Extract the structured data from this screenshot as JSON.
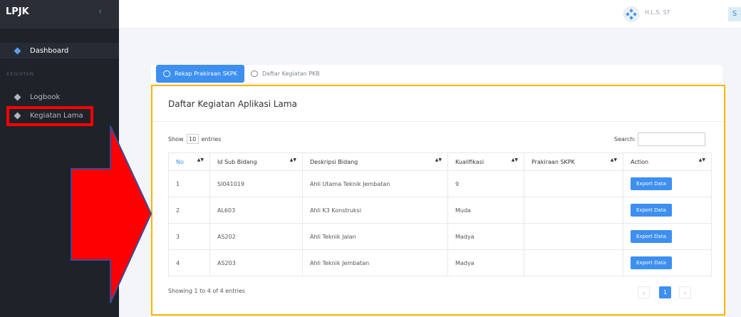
{
  "app": {
    "brand": "LPJK",
    "collapse_glyph": "‹"
  },
  "sidebar": {
    "dashboard_label": "Dashboard",
    "section_label": "KEGIATAN",
    "items": [
      {
        "label": "Logbook"
      },
      {
        "label": "Kegiatan Lama"
      }
    ]
  },
  "header": {
    "user_name": "H.L.S. ST",
    "avatar_letter": "S"
  },
  "tabs": [
    {
      "label": "Rekap Prakiraan SKPK",
      "active": true
    },
    {
      "label": "Daftar Kegiatan PKB",
      "active": false
    }
  ],
  "card": {
    "title": "Daftar Kegiatan Aplikasi Lama",
    "show_label": "Show",
    "entries_value": "10",
    "entries_label": "entries",
    "search_label": "Search:",
    "search_value": ""
  },
  "table": {
    "columns": [
      "No",
      "Id Sub Bidang",
      "Deskripsi Bidang",
      "Kualifikasi",
      "Prakiraan SKPK",
      "Action"
    ],
    "rows": [
      {
        "no": "1",
        "id": "SI041019",
        "desc": "Ahli Utama Teknik Jembatan",
        "kual": "9",
        "skpk": "",
        "action": "Export Data"
      },
      {
        "no": "2",
        "id": "AL603",
        "desc": "Ahli K3 Konstruksi",
        "kual": "Muda",
        "skpk": "",
        "action": "Export Data"
      },
      {
        "no": "3",
        "id": "AS202",
        "desc": "Ahli Teknik Jalan",
        "kual": "Madya",
        "skpk": "",
        "action": "Export Data"
      },
      {
        "no": "4",
        "id": "AS203",
        "desc": "Ahli Teknik Jembatan",
        "kual": "Madya",
        "skpk": "",
        "action": "Export Data"
      }
    ]
  },
  "pagination": {
    "info": "Showing 1 to 4 of 4 entries",
    "prev": "‹",
    "current": "1",
    "next": "›"
  },
  "colors": {
    "accent": "#3d8ff0",
    "highlight_box": "#f7b500",
    "annotation_red": "#ff0000",
    "sidebar_bg": "#1e2229"
  }
}
